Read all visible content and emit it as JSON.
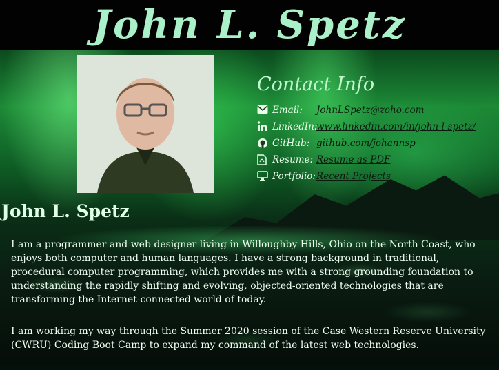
{
  "header": {
    "title": "John L. Spetz"
  },
  "contact": {
    "title": "Contact Info",
    "items": [
      {
        "icon": "envelope-icon",
        "label": "Email:",
        "value": "JohnLSpetz@zoho.com"
      },
      {
        "icon": "linkedin-icon",
        "label": "LinkedIn:",
        "value": "www.linkedin.com/in/john-l-spetz/"
      },
      {
        "icon": "github-icon",
        "label": "GitHub:",
        "value": "github.com/johannsp"
      },
      {
        "icon": "pdf-file-icon",
        "label": "Resume:",
        "value": "Resume as PDF"
      },
      {
        "icon": "monitor-icon",
        "label": "Portfolio:",
        "value": "Recent Projects"
      }
    ]
  },
  "about": {
    "name": "John L. Spetz",
    "paragraphs": [
      "I am a programmer and web designer living in Willoughby Hills, Ohio on the North Coast, who enjoys both computer and human languages. I have a strong background in traditional, procedural computer programming, which provides me with a strong grounding foundation to understanding the rapidly shifting and evolving, objected-oriented technologies that are transforming the Internet-connected world of today.",
      "I am working my way through the Summer 2020 session of the Case Western Reserve University (CWRU) Coding Boot Camp to expand my command of the latest web technologies."
    ]
  },
  "colors": {
    "title": "#aaf0c8",
    "header_bg": "#020202",
    "link": "#0b1a0e"
  }
}
